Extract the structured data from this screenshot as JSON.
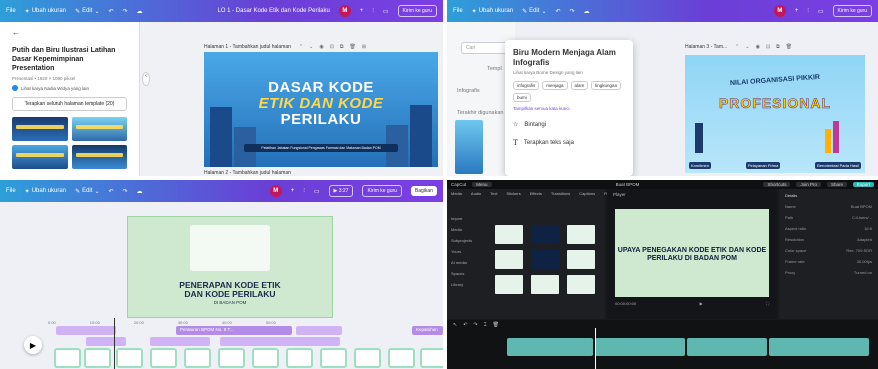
{
  "panel1": {
    "toolbar": {
      "file": "File",
      "resize": "Ubah ukuran",
      "edit": "Edit",
      "doc_title": "LO 1 - Dasar Kode Etik dan Kode Perilaku",
      "avatar": "M",
      "share": "Kirim ke guru"
    },
    "sidebar": {
      "back": "←",
      "title": "Putih dan Biru Ilustrasi Latihan Dasar Kepemimpinan Presentation",
      "meta": "Presentasi • 1920 × 1080 piksel",
      "author": "Lihat karya Nadia Widya yang lain",
      "apply_button": "Terapkan seluruh halaman template (20)"
    },
    "page1_header": "Halaman 1 - Tambahkan judul halaman",
    "page2_header": "Halaman 2 - Tambahkan judul halaman",
    "slide": {
      "line1": "DASAR KODE",
      "line2": "ETIK DAN KODE",
      "line3": "PERILAKU",
      "subtitle": "Pelatihan Jabatan Fungsional Pengawas Farmasi dan Makanan Badan POM"
    }
  },
  "panel2": {
    "toolbar": {
      "file": "File",
      "resize": "Ubah ukuran",
      "edit": "Edit",
      "avatar": "M",
      "share": "Kirim ke guru"
    },
    "search_placeholder": "Cari",
    "left_labels": [
      "Templ",
      "Infografis",
      "Terakhir digunakan"
    ],
    "popover": {
      "title": "Biru Modern Menjaga Alam Infografis",
      "by": "Lihat karya Borne Design yang lain",
      "tags": [
        "infografis",
        "menjaga",
        "alam",
        "lingkungan",
        "bumi"
      ],
      "show_all": "Tampilkan semua kata kunci",
      "star_action": "Bintangi",
      "apply_action": "Terapkan teks saja"
    },
    "page_header": "Halaman 3 - Tam...",
    "slide": {
      "arc": "NILAI ORGANISASI PIKKIR",
      "big": "PROFESIONAL",
      "labels": [
        "Komitmen",
        "Pelayanan Prima",
        "Berorientasi Pada Hasil"
      ]
    }
  },
  "panel3": {
    "toolbar": {
      "file": "File",
      "resize": "Ubah ukuran",
      "edit": "Edit",
      "avatar": "M",
      "time": "3:27",
      "share": "Kirim ke guru",
      "share2": "Bagikan"
    },
    "slide": {
      "line1": "PENERAPAN KODE ETIK",
      "line2": "DAN KODE PERILAKU",
      "line3": "DI BADAN POM"
    },
    "ruler": [
      "0:00",
      "10:00",
      "20:00",
      "30:00",
      "40:00",
      "50:00"
    ],
    "tracks": {
      "long": "Peraturan BPOM No. 8 T...",
      "right": "Kepatuhan"
    }
  },
  "panel4": {
    "topbar": {
      "app": "CapCut",
      "menu": "Menu",
      "title": "Buat BPOM",
      "shortcuts": "Shortcuts",
      "pro": "Join Pro",
      "share": "Share",
      "export": "Export"
    },
    "tabs": [
      "Media",
      "Audio",
      "Text",
      "Stickers",
      "Effects",
      "Transitions",
      "Captions",
      "Filters"
    ],
    "side": [
      "Import",
      "Media",
      "Subprojects",
      "Yours",
      "AI media",
      "Spaces",
      "Library"
    ],
    "preview": {
      "header": "Player",
      "title": "UPAYA PENEGAKAN KODE ETIK DAN KODE PERILAKU DI BADAN POM",
      "time": "00:00:00:00"
    },
    "details": {
      "header": "Details",
      "rows": [
        [
          "Name",
          "Buat BPOM"
        ],
        [
          "Path",
          "C:/Users/..."
        ],
        [
          "Aspect ratio",
          "16:9"
        ],
        [
          "Resolution",
          "Adapted"
        ],
        [
          "Color space",
          "Rec. 709 SDR"
        ],
        [
          "Frame rate",
          "30.00fps"
        ],
        [
          "Proxy",
          "Turned on"
        ]
      ]
    }
  },
  "colors": {
    "canva_grad_start": "#2d9fd9",
    "canva_grad_end": "#7b3fe4",
    "capcut_bg": "#18191c",
    "capcut_accent": "#2fb6b0"
  }
}
